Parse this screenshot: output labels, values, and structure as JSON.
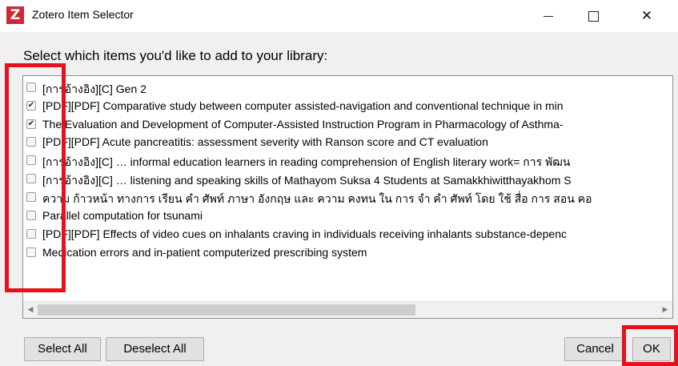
{
  "window": {
    "title": "Zotero Item Selector",
    "logo_letter": "Z",
    "controls": {
      "minimize": "minimize",
      "maximize": "maximize",
      "close": "✕"
    }
  },
  "prompt": "Select which items you'd like to add to your library:",
  "items": [
    {
      "label": "[การอ้างอิง][C] Gen 2",
      "checked": false
    },
    {
      "label": "[PDF][PDF] Comparative study between computer assisted-navigation and conventional technique in min",
      "checked": true
    },
    {
      "label": "The Evaluation and Development of Computer-Assisted Instruction Program in Pharmacology of Asthma-",
      "checked": true
    },
    {
      "label": "[PDF][PDF] Acute pancreatitis: assessment severity with Ranson score and CT evaluation",
      "checked": false
    },
    {
      "label": "[การอ้างอิง][C] … informal education learners in reading comprehension of English literary work= การ พัฒน",
      "checked": false
    },
    {
      "label": "[การอ้างอิง][C] … listening and speaking skills of Mathayom Suksa 4 Students at Samakkhiwitthayakhom S",
      "checked": false
    },
    {
      "label": "ความ ก้าวหน้า ทางการ เรียน คำ ศัพท์ ภาษา อังกฤษ และ ความ คงทน ใน การ จำ คำ ศัพท์ โดย ใช้ สื่อ การ สอน คอ",
      "checked": false
    },
    {
      "label": "Parallel computation for tsunami",
      "checked": false
    },
    {
      "label": "[PDF][PDF] Effects of video cues on inhalants craving in individuals receiving inhalants substance-depenc",
      "checked": false
    },
    {
      "label": "Medication errors and in-patient computerized prescribing system",
      "checked": false
    }
  ],
  "scrollbar": {
    "left_arrow": "◀",
    "right_arrow": "▶"
  },
  "buttons": {
    "select_all": "Select All",
    "deselect_all": "Deselect All",
    "cancel": "Cancel",
    "ok": "OK"
  },
  "colors": {
    "annotation_red": "#e8101a",
    "zotero_red": "#cc2936"
  }
}
